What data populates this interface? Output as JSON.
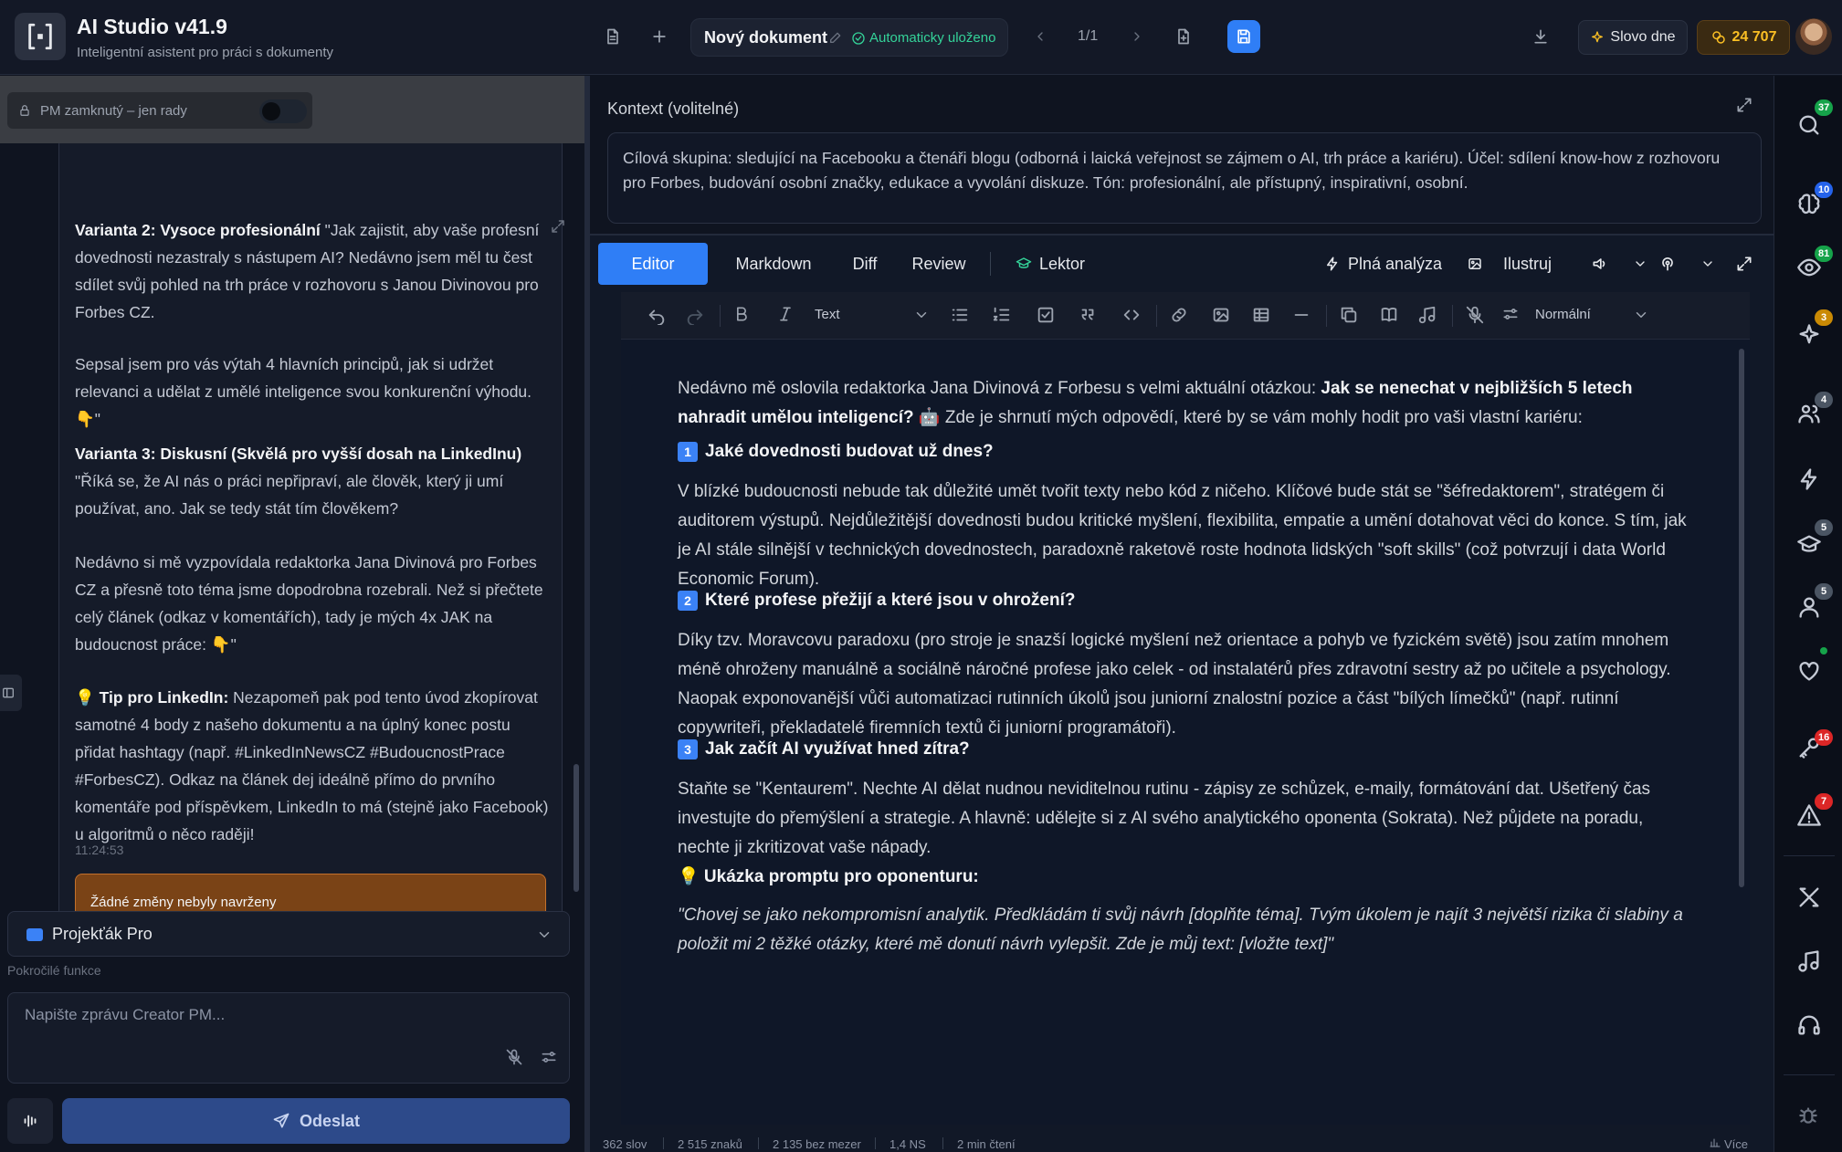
{
  "header": {
    "app_title": "AI Studio v41.9",
    "app_subtitle": "Inteligentní asistent pro práci s dokumenty",
    "doc_title": "Nový dokument",
    "doc_saved": "Automaticky uloženo",
    "page_indicator": "1/1",
    "word_of_day": "Slovo dne",
    "credits": "24 707"
  },
  "left": {
    "pm_lock_label": "PM zamknutý – jen rady",
    "message": {
      "p1_bold": "Varianta 2: Vysoce profesionální",
      "p1_text": " \"Jak zajistit, aby vaše profesní dovednosti nezastraly s nástupem AI? Nedávno jsem měl tu čest sdílet svůj pohled na trh práce v rozhovoru s Janou Divinovou pro Forbes CZ.",
      "p2_text": "Sepsal jsem pro vás výtah 4 hlavních principů, jak si udržet relevanci a udělat z umělé inteligence svou konkurenční výhodu. 👇\"",
      "p3_bold": "Varianta 3: Diskusní (Skvělá pro vyšší dosah na LinkedInu)",
      "p3_text": " \"Říká se, že AI nás o práci nepřipraví, ale člověk, který ji umí používat, ano. Jak se tedy stát tím člověkem?",
      "p4_text": "Nedávno si mě vyzpovídala redaktorka Jana Divinová pro Forbes CZ a přesně toto téma jsme dopodrobna rozebrali. Než si přečtete celý článek (odkaz v komentářích), tady je mých 4x JAK na budoucnost práce: 👇\"",
      "p5_bold": "💡 Tip pro LinkedIn:",
      "p5_text": " Nezapomeň pak pod tento úvod zkopírovat samotné 4 body z našeho dokumentu a na úplný konec postu přidat hashtagy (např. #LinkedInNewsCZ #BudoucnostPrace #ForbesCZ). Odkaz na článek dej ideálně přímo do prvního komentáře pod příspěvkem, LinkedIn to má (stejně jako Facebook) u algoritmů o něco raději!",
      "time": "11:24:53",
      "no_changes": "Žádné změny nebyly navrženy"
    },
    "project": "Projekťák Pro",
    "advanced_label": "Pokročilé funkce",
    "input_placeholder": "Napište zprávu Creator PM...",
    "send_label": "Odeslat"
  },
  "context": {
    "label": "Kontext (volitelné)",
    "text": "Cílová skupina: sledující na Facebooku a čtenáři blogu (odborná i laická veřejnost se zájmem o AI, trh práce a kariéru). Účel: sdílení know-how z rozhovoru pro Forbes, budování osobní značky, edukace a vyvolání diskuze. Tón: profesionální, ale přístupný, inspirativní, osobní."
  },
  "editor": {
    "tabs": [
      "Editor",
      "Markdown",
      "Diff",
      "Review"
    ],
    "lektor": "Lektor",
    "full_analysis": "Plná analýza",
    "illustrate": "Ilustruj",
    "text_style": "Text",
    "paragraph_style": "Normální",
    "content": {
      "intro_a": "Nedávno mě oslovila redaktorka Jana Divinová z Forbesu s velmi aktuální otázkou: ",
      "intro_b": "Jak se nenechat v nejbližších 5 letech nahradit umělou inteligencí?",
      "intro_c": " 🤖 Zde je shrnutí mých odpovědí, které by se vám mohly hodit pro vaši vlastní kariéru:",
      "h1_num": "1",
      "h1": "Jaké dovednosti budovat už dnes?",
      "p1": "V blízké budoucnosti nebude tak důležité umět tvořit texty nebo kód z ničeho. Klíčové bude stát se \"šéfredaktorem\", stratégem či auditorem výstupů. Nejdůležitější dovednosti budou kritické myšlení, flexibilita, empatie a umění dotahovat věci do konce. S tím, jak je AI stále silnější v technických dovednostech, paradoxně raketově roste hodnota lidských \"soft skills\" (což potvrzují i data World Economic Forum).",
      "h2_num": "2",
      "h2": "Které profese přežijí a které jsou v ohrožení?",
      "p2": "Díky tzv. Moravcovu paradoxu (pro stroje je snazší logické myšlení než orientace a pohyb ve fyzickém světě) jsou zatím mnohem méně ohroženy manuálně a sociálně náročné profese jako celek - od instalatérů přes zdravotní sestry až po učitele a psychology. Naopak exponovanější vůči automatizaci rutinních úkolů jsou juniorní znalostní pozice a část \"bílých límečků\" (např. rutinní copywriteři, překladatelé firemních textů či juniorní programátoři).",
      "h3_num": "3",
      "h3": "Jak začít AI využívat hned zítra?",
      "p3": "Staňte se \"Kentaurem\". Nechte AI dělat nudnou neviditelnou rutinu - zápisy ze schůzek, e-maily, formátování dat. Ušetřený čas investujte do přemýšlení a strategie. A hlavně: udělejte si z AI svého analytického oponenta (Sokrata). Než půjdete na poradu, nechte ji zkritizovat vaše nápady.",
      "h4": "💡 Ukázka promptu pro oponenturu:",
      "quote": "\"Chovej se jako nekompromisní analytik. Předkládám ti svůj návrh [doplňte téma]. Tvým úkolem je najít 3 největší rizika či slabiny a položit mi 2 těžké otázky, které mě donutí návrh vylepšit. Zde je můj text: [vložte text]\""
    },
    "status": {
      "words": "362 slov",
      "chars": "2 515 znaků",
      "chars_no_spaces": "2 135 bez mezer",
      "ns": "1,4 NS",
      "read_time": "2 min čtení",
      "more": "Více"
    }
  },
  "rail": {
    "badges": [
      "37",
      "10",
      "81",
      "3",
      "4",
      "5",
      "5",
      "16",
      "7"
    ],
    "colors": {
      "green": "#16a34a",
      "blue": "#2563eb",
      "yellow": "#ca8a04",
      "gray": "#4b5563",
      "red": "#dc2626"
    }
  },
  "colors": {
    "accent": "#2f7ef6",
    "saved": "#34d399",
    "credits": "#fbbf24",
    "no_changes_bg": "#7a4316"
  }
}
